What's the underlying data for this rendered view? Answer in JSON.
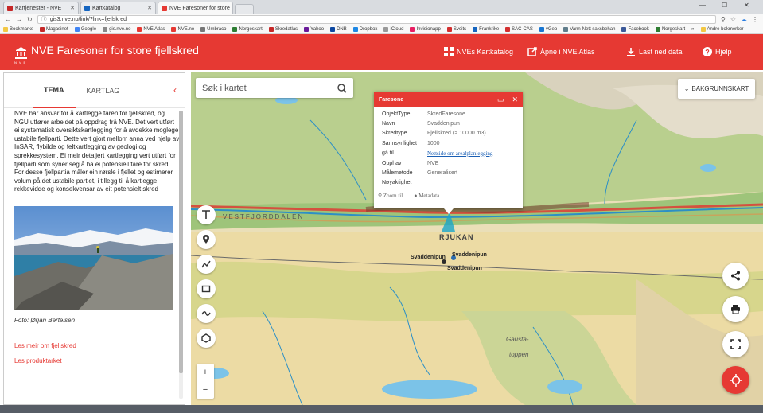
{
  "browser": {
    "tabs": [
      {
        "label": "Kartjenester - NVE",
        "color": "#c62828"
      },
      {
        "label": "Kartkatalog",
        "color": "#1565c0"
      },
      {
        "label": "NVE Faresoner for store",
        "color": "#e63933"
      }
    ],
    "address": "gis3.nve.no/link/?link=fjellskred",
    "bookmarks": [
      "Bookmarks",
      "Magasinet",
      "Google",
      "gis.nve.no",
      "NVE Atlas",
      "NVE.no",
      "Umbraco",
      "Norgeskart",
      "Skredatlas",
      "Yahoo",
      "DNB",
      "Dropbox",
      "iCloud",
      "Invisionapp",
      "Sveits",
      "Frankrike",
      "SAC-CAS",
      "vGeo",
      "Vann-Nett saksbehan",
      "Facebook",
      "Norgeskart"
    ],
    "other_bookmarks": "Andre bokmerker"
  },
  "header": {
    "logo_text": "NVE",
    "title": "NVE Faresoner for store fjellskred",
    "nav": [
      "NVEs Kartkatalog",
      "Åpne i NVE Atlas",
      "Last ned data",
      "Hjelp"
    ],
    "color": "#e63933"
  },
  "sidebar": {
    "tabs": [
      "TEMA",
      "KARTLAG"
    ],
    "description": "NVE har ansvar for å kartlegge faren for fjellskred, og NGU utfører arbeidet på oppdrag frå NVE. Det vert utført ei systematisk oversiktskartlegging for å avdekke moglege ustabile fjellparti. Dette vert gjort mellom anna ved hjelp av InSAR, flybilde og feltkartlegging av geologi og sprekkesystem. Ei meir detaljert kartlegging vert utført for fjellparti som syner seg å ha ei potensiell fare for skred. For desse fjellpartia måler ein rørsle i fjellet og estimerer volum på det ustabile partiet, i tillegg til å kartlegge rekkevidde og konsekvensar av eit potensielt skred",
    "photo_caption": "Foto: Ørjan Bertelsen",
    "links": [
      "Les meir om fjellskred",
      "Les produktarket"
    ]
  },
  "map": {
    "search_placeholder": "Søk i kartet",
    "background_button": "BAKGRUNNSKART",
    "labels": {
      "valley": "VESTFJORDDALEN",
      "town": "RJUKAN",
      "marker1": "Svaddenipun",
      "marker2": "Svaddenipun",
      "marker3": "Svaddenipun",
      "peak": "Gausta-",
      "peak2": "toppen"
    },
    "zoom_in": "+",
    "zoom_out": "−"
  },
  "popup": {
    "title": "Faresone",
    "rows": [
      {
        "key": "ObjektType",
        "value": "SkredFaresone"
      },
      {
        "key": "Navn",
        "value": "Svaddenipun"
      },
      {
        "key": "Skredtype",
        "value": "Fjellskred (> 10000 m3)"
      },
      {
        "key": "Sannsynlighet",
        "value": "1000"
      },
      {
        "key": "gå til",
        "value": "Nettside om arealplanlegging"
      },
      {
        "key": "Opphav",
        "value": "NVE"
      },
      {
        "key": "Målemetode",
        "value": "Generalisert"
      },
      {
        "key": "Nøyaktighet",
        "value": ""
      }
    ],
    "footer": [
      "Zoom til",
      "Metadata"
    ]
  }
}
